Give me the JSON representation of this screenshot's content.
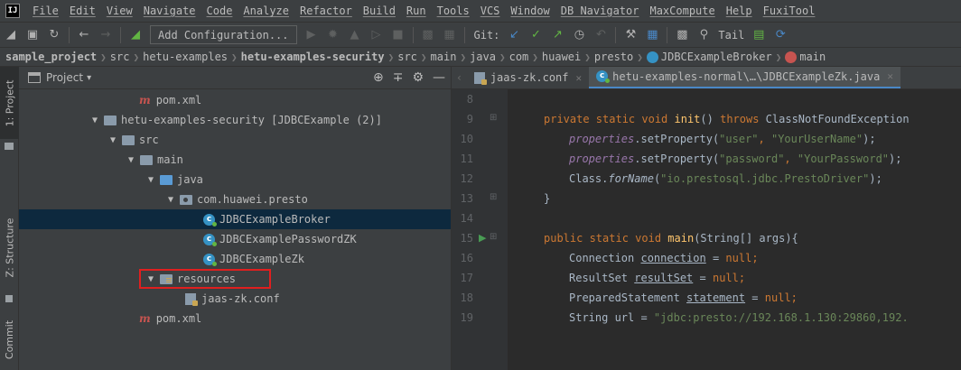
{
  "menubar": {
    "logo": "IJ",
    "items": [
      "File",
      "Edit",
      "View",
      "Navigate",
      "Code",
      "Analyze",
      "Refactor",
      "Build",
      "Run",
      "Tools",
      "VCS",
      "Window",
      "DB Navigator",
      "MaxCompute",
      "Help",
      "FuxiTool"
    ]
  },
  "toolbar": {
    "run_config": "Add Configuration...",
    "git_label": "Git:",
    "tail_label": "Tail"
  },
  "breadcrumb": {
    "items": [
      "sample_project",
      "src",
      "hetu-examples",
      "hetu-examples-security",
      "src",
      "main",
      "java",
      "com",
      "huawei",
      "presto",
      "JDBCExampleBroker",
      "main"
    ]
  },
  "left_strip": {
    "tabs": [
      "1: Project",
      "Z: Structure",
      "Commit"
    ]
  },
  "project_panel": {
    "title": "Project",
    "dropdown_glyph": "▾",
    "tree": [
      {
        "label": "pom.xml",
        "type": "maven"
      },
      {
        "label": "hetu-examples-security [JDBCExample (2)]",
        "type": "module"
      },
      {
        "label": "src",
        "type": "folder"
      },
      {
        "label": "main",
        "type": "folder"
      },
      {
        "label": "java",
        "type": "folder-blue"
      },
      {
        "label": "com.huawei.presto",
        "type": "package"
      },
      {
        "label": "JDBCExampleBroker",
        "type": "class",
        "selected": true
      },
      {
        "label": "JDBCExamplePasswordZK",
        "type": "class"
      },
      {
        "label": "JDBCExampleZk",
        "type": "class"
      },
      {
        "label": "resources",
        "type": "resources",
        "highlighted": true
      },
      {
        "label": "jaas-zk.conf",
        "type": "conf"
      },
      {
        "label": "pom.xml",
        "type": "maven"
      }
    ]
  },
  "editor": {
    "tabs": [
      {
        "label": "jaas-zk.conf",
        "active": false
      },
      {
        "label": "hetu-examples-normal\\…\\JDBCExampleZk.java",
        "active": true
      }
    ],
    "line_numbers": [
      "8",
      "9",
      "10",
      "11",
      "12",
      "13",
      "14",
      "15",
      "16",
      "17",
      "18",
      "19"
    ],
    "code": {
      "l9_kw1": "private static void ",
      "l9_fn": "init",
      "l9_mid": "() ",
      "l9_kw2": "throws ",
      "l9_rest": "ClassNotFoundException",
      "l10_fld": "properties",
      "l10_mid": ".setProperty(",
      "l10_s1": "\"user\"",
      "l10_comma": ", ",
      "l10_s2": "\"YourUserName\"",
      "l10_end": ");",
      "l11_fld": "properties",
      "l11_mid": ".setProperty(",
      "l11_s1": "\"password\"",
      "l11_comma": ", ",
      "l11_s2": "\"YourPassword\"",
      "l11_end": ");",
      "l12_a": "Class.",
      "l12_it": "forName",
      "l12_b": "(",
      "l12_s": "\"io.prestosql.jdbc.PrestoDriver\"",
      "l12_end": ");",
      "l13": "}",
      "l15_kw": "public static void ",
      "l15_fn": "main",
      "l15_rest": "(String[] args){",
      "l16_a": "Connection ",
      "l16_var": "connection",
      "l16_b": " = ",
      "l16_kw": "null",
      "l16_end": ";",
      "l17_a": "ResultSet ",
      "l17_var": "resultSet",
      "l17_b": " = ",
      "l17_kw": "null",
      "l17_end": ";",
      "l18_a": "PreparedStatement ",
      "l18_var": "statement",
      "l18_b": " = ",
      "l18_kw": "null",
      "l18_end": ";",
      "l19_a": "String url = ",
      "l19_s": "\"jdbc:presto://192.168.1.130:29860,192."
    }
  },
  "colors": {
    "highlight_box": "#e01f1f",
    "selection": "#0d293e",
    "keyword": "#cc7832",
    "string": "#6a8759",
    "field": "#9876aa",
    "function": "#ffc66d"
  }
}
